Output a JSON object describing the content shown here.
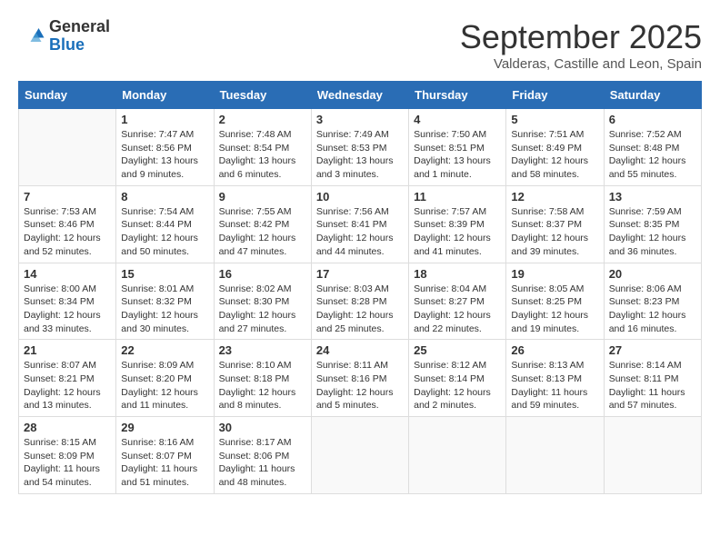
{
  "header": {
    "logo": {
      "general": "General",
      "blue": "Blue"
    },
    "title": "September 2025",
    "subtitle": "Valderas, Castille and Leon, Spain"
  },
  "weekdays": [
    "Sunday",
    "Monday",
    "Tuesday",
    "Wednesday",
    "Thursday",
    "Friday",
    "Saturday"
  ],
  "weeks": [
    [
      {
        "day": "",
        "info": ""
      },
      {
        "day": "1",
        "info": "Sunrise: 7:47 AM\nSunset: 8:56 PM\nDaylight: 13 hours\nand 9 minutes."
      },
      {
        "day": "2",
        "info": "Sunrise: 7:48 AM\nSunset: 8:54 PM\nDaylight: 13 hours\nand 6 minutes."
      },
      {
        "day": "3",
        "info": "Sunrise: 7:49 AM\nSunset: 8:53 PM\nDaylight: 13 hours\nand 3 minutes."
      },
      {
        "day": "4",
        "info": "Sunrise: 7:50 AM\nSunset: 8:51 PM\nDaylight: 13 hours\nand 1 minute."
      },
      {
        "day": "5",
        "info": "Sunrise: 7:51 AM\nSunset: 8:49 PM\nDaylight: 12 hours\nand 58 minutes."
      },
      {
        "day": "6",
        "info": "Sunrise: 7:52 AM\nSunset: 8:48 PM\nDaylight: 12 hours\nand 55 minutes."
      }
    ],
    [
      {
        "day": "7",
        "info": "Sunrise: 7:53 AM\nSunset: 8:46 PM\nDaylight: 12 hours\nand 52 minutes."
      },
      {
        "day": "8",
        "info": "Sunrise: 7:54 AM\nSunset: 8:44 PM\nDaylight: 12 hours\nand 50 minutes."
      },
      {
        "day": "9",
        "info": "Sunrise: 7:55 AM\nSunset: 8:42 PM\nDaylight: 12 hours\nand 47 minutes."
      },
      {
        "day": "10",
        "info": "Sunrise: 7:56 AM\nSunset: 8:41 PM\nDaylight: 12 hours\nand 44 minutes."
      },
      {
        "day": "11",
        "info": "Sunrise: 7:57 AM\nSunset: 8:39 PM\nDaylight: 12 hours\nand 41 minutes."
      },
      {
        "day": "12",
        "info": "Sunrise: 7:58 AM\nSunset: 8:37 PM\nDaylight: 12 hours\nand 39 minutes."
      },
      {
        "day": "13",
        "info": "Sunrise: 7:59 AM\nSunset: 8:35 PM\nDaylight: 12 hours\nand 36 minutes."
      }
    ],
    [
      {
        "day": "14",
        "info": "Sunrise: 8:00 AM\nSunset: 8:34 PM\nDaylight: 12 hours\nand 33 minutes."
      },
      {
        "day": "15",
        "info": "Sunrise: 8:01 AM\nSunset: 8:32 PM\nDaylight: 12 hours\nand 30 minutes."
      },
      {
        "day": "16",
        "info": "Sunrise: 8:02 AM\nSunset: 8:30 PM\nDaylight: 12 hours\nand 27 minutes."
      },
      {
        "day": "17",
        "info": "Sunrise: 8:03 AM\nSunset: 8:28 PM\nDaylight: 12 hours\nand 25 minutes."
      },
      {
        "day": "18",
        "info": "Sunrise: 8:04 AM\nSunset: 8:27 PM\nDaylight: 12 hours\nand 22 minutes."
      },
      {
        "day": "19",
        "info": "Sunrise: 8:05 AM\nSunset: 8:25 PM\nDaylight: 12 hours\nand 19 minutes."
      },
      {
        "day": "20",
        "info": "Sunrise: 8:06 AM\nSunset: 8:23 PM\nDaylight: 12 hours\nand 16 minutes."
      }
    ],
    [
      {
        "day": "21",
        "info": "Sunrise: 8:07 AM\nSunset: 8:21 PM\nDaylight: 12 hours\nand 13 minutes."
      },
      {
        "day": "22",
        "info": "Sunrise: 8:09 AM\nSunset: 8:20 PM\nDaylight: 12 hours\nand 11 minutes."
      },
      {
        "day": "23",
        "info": "Sunrise: 8:10 AM\nSunset: 8:18 PM\nDaylight: 12 hours\nand 8 minutes."
      },
      {
        "day": "24",
        "info": "Sunrise: 8:11 AM\nSunset: 8:16 PM\nDaylight: 12 hours\nand 5 minutes."
      },
      {
        "day": "25",
        "info": "Sunrise: 8:12 AM\nSunset: 8:14 PM\nDaylight: 12 hours\nand 2 minutes."
      },
      {
        "day": "26",
        "info": "Sunrise: 8:13 AM\nSunset: 8:13 PM\nDaylight: 11 hours\nand 59 minutes."
      },
      {
        "day": "27",
        "info": "Sunrise: 8:14 AM\nSunset: 8:11 PM\nDaylight: 11 hours\nand 57 minutes."
      }
    ],
    [
      {
        "day": "28",
        "info": "Sunrise: 8:15 AM\nSunset: 8:09 PM\nDaylight: 11 hours\nand 54 minutes."
      },
      {
        "day": "29",
        "info": "Sunrise: 8:16 AM\nSunset: 8:07 PM\nDaylight: 11 hours\nand 51 minutes."
      },
      {
        "day": "30",
        "info": "Sunrise: 8:17 AM\nSunset: 8:06 PM\nDaylight: 11 hours\nand 48 minutes."
      },
      {
        "day": "",
        "info": ""
      },
      {
        "day": "",
        "info": ""
      },
      {
        "day": "",
        "info": ""
      },
      {
        "day": "",
        "info": ""
      }
    ]
  ]
}
